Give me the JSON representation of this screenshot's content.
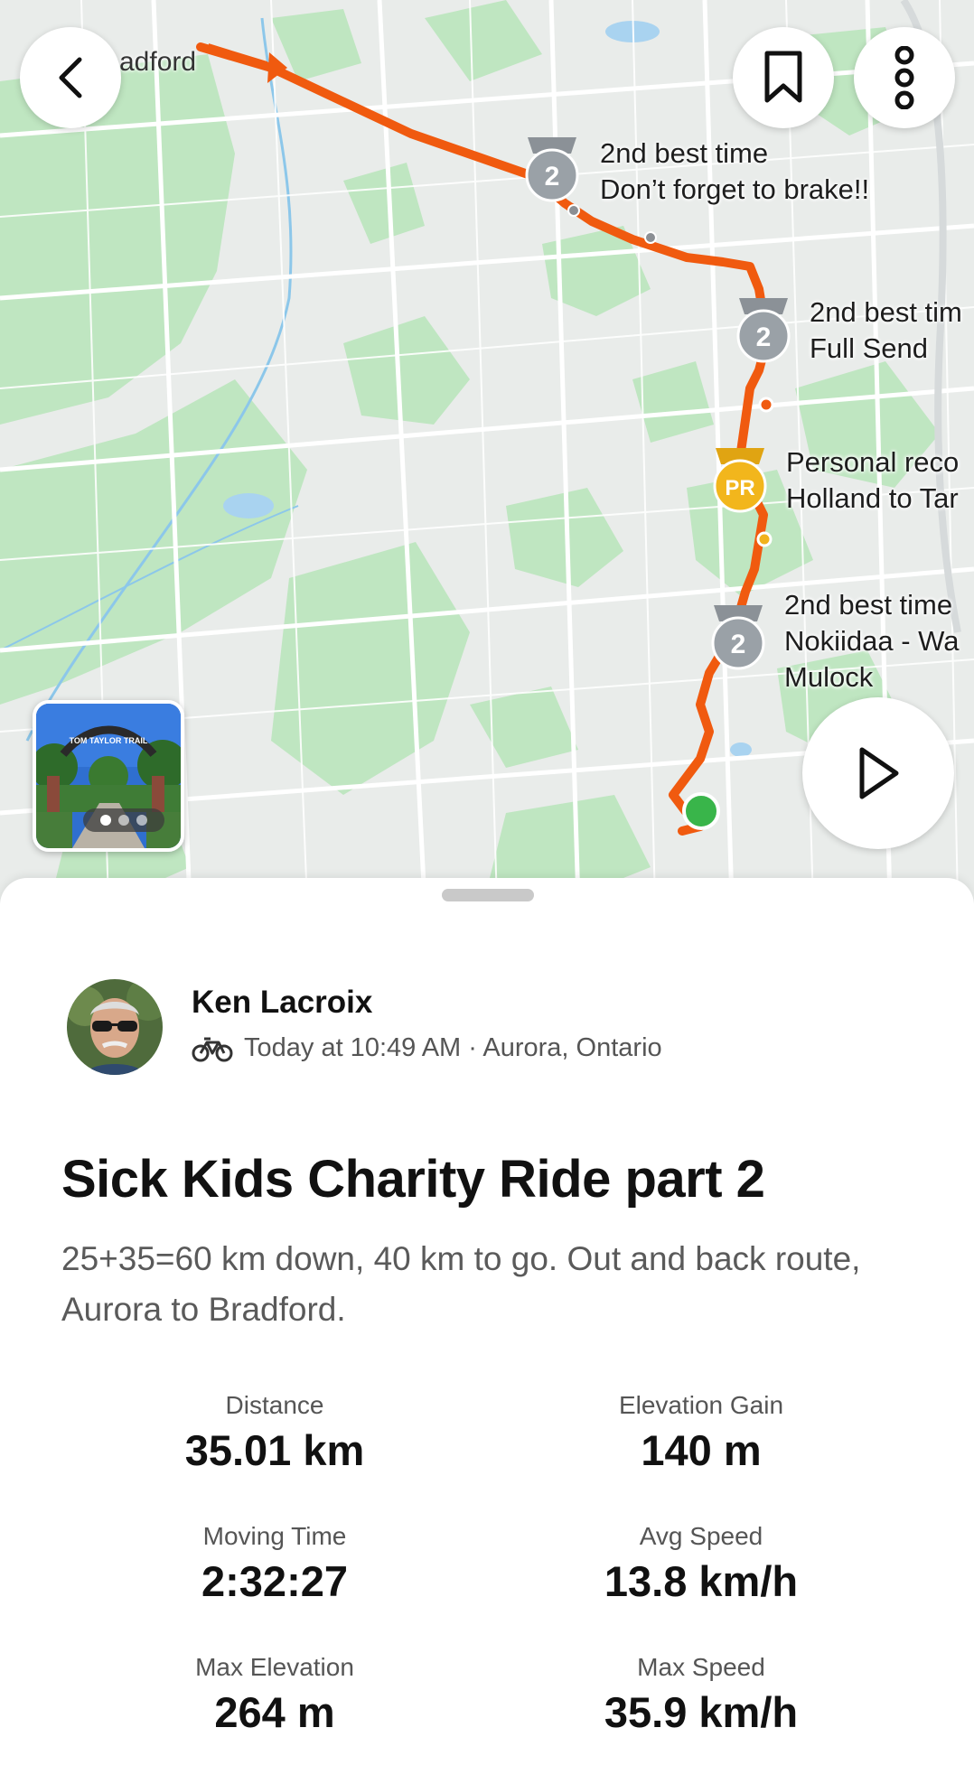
{
  "map": {
    "town_label": "adford",
    "segments": [
      {
        "medal": "2",
        "kind": "silver",
        "line1": "2nd best time",
        "line2": "Don’t forget to brake!!",
        "line3": ""
      },
      {
        "medal": "2",
        "kind": "silver",
        "line1": "2nd best tim",
        "line2": "Full Send",
        "line3": ""
      },
      {
        "medal": "PR",
        "kind": "gold",
        "line1": "Personal reco",
        "line2": "Holland to Tar",
        "line3": ""
      },
      {
        "medal": "2",
        "kind": "silver",
        "line1": "2nd best time",
        "line2": "Nokiidaa - Wa",
        "line3": "Mulock"
      }
    ],
    "photo": {
      "caption": "TOM TAYLOR TRAIL"
    },
    "colors": {
      "route": "#f05a0f",
      "start": "#39b54a",
      "park": "#bfe6c1",
      "road": "#ffffff"
    }
  },
  "buttons": {
    "back": "chevron-left-icon",
    "save": "bookmark-icon",
    "more": "more-vertical-icon",
    "play": "play-icon"
  },
  "activity": {
    "athlete": "Ken Lacroix",
    "meta": "Today at 10:49 AM · Aurora, Ontario",
    "title": "Sick Kids Charity Ride part 2",
    "description": "25+35=60 km down, 40 km to go. Out and back route, Aurora to Bradford."
  },
  "stats": [
    {
      "label": "Distance",
      "value": "35.01 km"
    },
    {
      "label": "Elevation Gain",
      "value": "140 m"
    },
    {
      "label": "Moving Time",
      "value": "2:32:27"
    },
    {
      "label": "Avg Speed",
      "value": "13.8 km/h"
    },
    {
      "label": "Max Elevation",
      "value": "264 m"
    },
    {
      "label": "Max Speed",
      "value": "35.9 km/h"
    }
  ]
}
